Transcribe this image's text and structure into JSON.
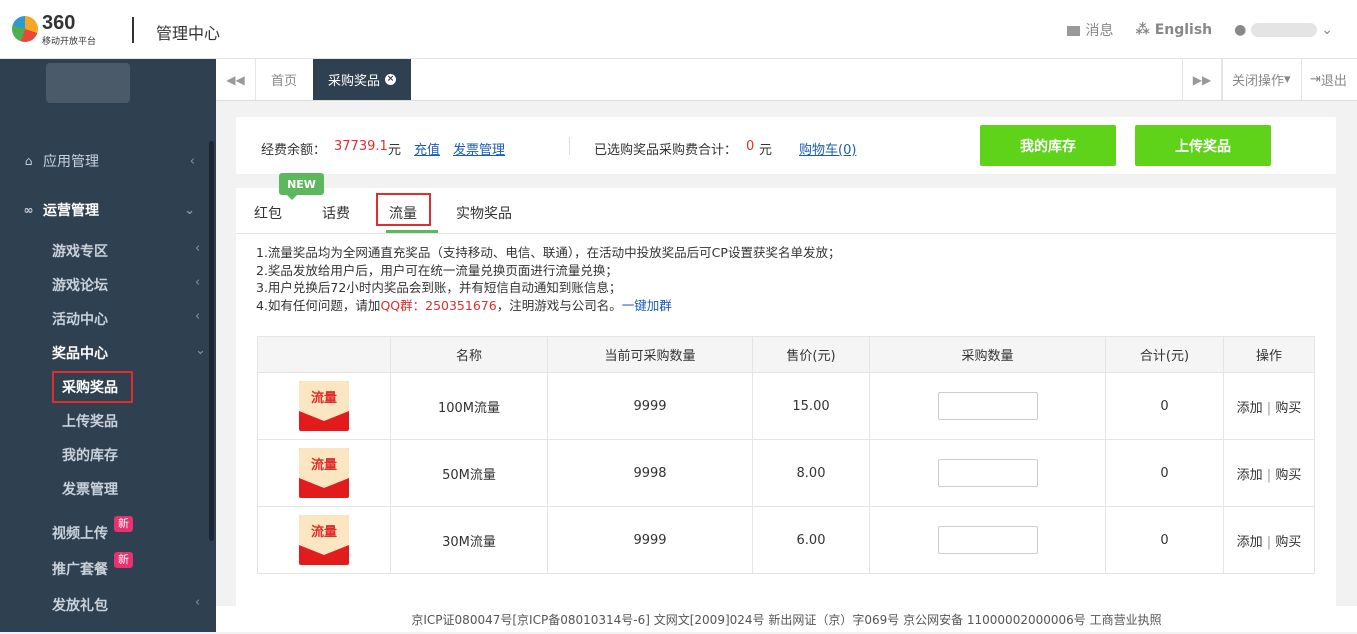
{
  "header": {
    "logo_num": "360",
    "logo_sub": "移动开放平台",
    "title": "管理中心",
    "messages": "消息",
    "language": "English"
  },
  "sidebar": {
    "app_mgmt": "应用管理",
    "ops_mgmt": "运营管理",
    "game_zone": "游戏专区",
    "game_forum": "游戏论坛",
    "activity": "活动中心",
    "prize_center": "奖品中心",
    "buy_prize": "采购奖品",
    "upload_prize": "上传奖品",
    "my_stock": "我的库存",
    "invoice": "发票管理",
    "video_upload": "视频上传",
    "promo": "推广套餐",
    "gift": "发放礼包",
    "new_badge": "新"
  },
  "tabs": {
    "home": "首页",
    "active": "采购奖品",
    "close_ops": "关闭操作",
    "logout": "退出"
  },
  "funds": {
    "balance_label": "经费余额：",
    "balance_value": "37739.1",
    "unit": "元",
    "recharge": "充值",
    "invoice": "发票管理",
    "selected_label": "已选购奖品采购费合计：",
    "selected_value": "0",
    "cart": "购物车(0)",
    "my_stock_btn": "我的库存",
    "upload_btn": "上传奖品"
  },
  "prize_tabs": {
    "new": "NEW",
    "hongbao": "红包",
    "huafei": "话费",
    "liuliang": "流量",
    "shiwu": "实物奖品"
  },
  "notes": {
    "n1": "1.流量奖品均为全网通直充奖品（支持移动、电信、联通），在活动中投放奖品后可CP设置获奖名单发放；",
    "n2": "2.奖品发放给用户后，用户可在统一流量兑换页面进行流量兑换；",
    "n3": "3.用户兑换后72小时内奖品会到账，并有短信自动通知到账信息；",
    "n4a": "4.如有任何问题，请加",
    "n4qq": "QQ群：250351676",
    "n4b": "，注明游戏与公司名。",
    "n4link": "一键加群"
  },
  "table": {
    "headers": [
      "",
      "名称",
      "当前可采购数量",
      "售价(元)",
      "采购数量",
      "合计(元)",
      "操作"
    ],
    "prize_label": "流量",
    "rows": [
      {
        "name": "100M流量",
        "qty": "9999",
        "price": "15.00",
        "total": "0"
      },
      {
        "name": "50M流量",
        "qty": "9998",
        "price": "8.00",
        "total": "0"
      },
      {
        "name": "30M流量",
        "qty": "9999",
        "price": "6.00",
        "total": "0"
      }
    ],
    "add": "添加",
    "sep": "|",
    "buy": "购买"
  },
  "footer": "京ICP证080047号[京ICP备08010314号-6] 文网文[2009]024号 新出网证（京）字069号 京公网安备 11000002000006号 工商营业执照"
}
